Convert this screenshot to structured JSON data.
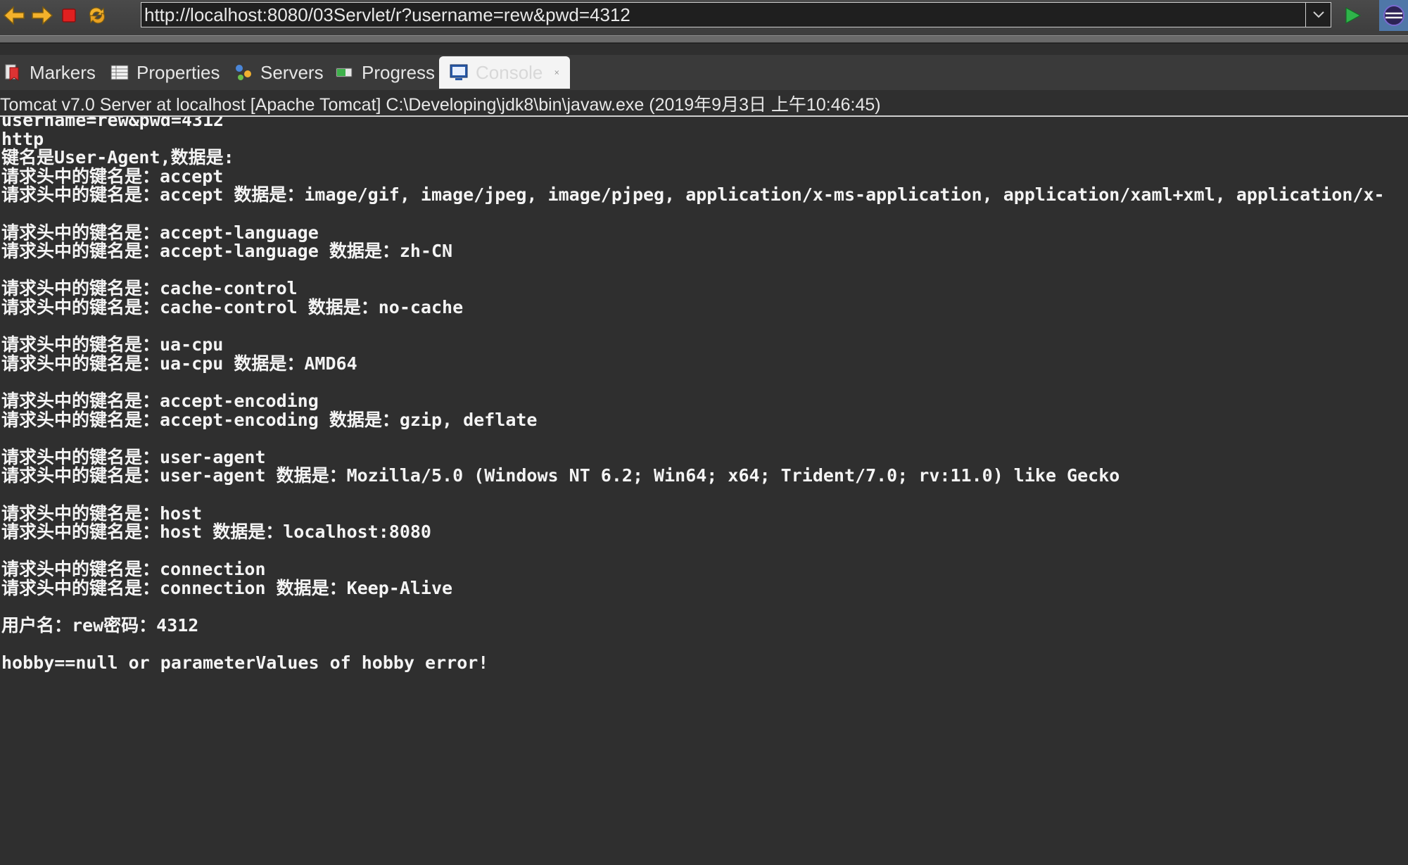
{
  "browser": {
    "url": "http://localhost:8080/03Servlet/r?username=rew&pwd=4312"
  },
  "tabs": [
    {
      "label": "Markers",
      "icon": "markers-icon"
    },
    {
      "label": "Properties",
      "icon": "properties-icon"
    },
    {
      "label": "Servers",
      "icon": "servers-icon"
    },
    {
      "label": "Progress",
      "icon": "progress-icon"
    },
    {
      "label": "Console",
      "icon": "console-icon",
      "active": true
    }
  ],
  "console": {
    "header": "Tomcat v7.0 Server at localhost [Apache Tomcat] C:\\Developing\\jdk8\\bin\\javaw.exe (2019年9月3日 上午10:46:45)",
    "cut_line": "/03Servlet/r",
    "lines": [
      "username=rew&pwd=4312",
      "http",
      "键名是User-Agent,数据是:",
      "请求头中的键名是：accept",
      "请求头中的键名是：accept 数据是：image/gif, image/jpeg, image/pjpeg, application/x-ms-application, application/xaml+xml, application/x-",
      "",
      "请求头中的键名是：accept-language",
      "请求头中的键名是：accept-language 数据是：zh-CN",
      "",
      "请求头中的键名是：cache-control",
      "请求头中的键名是：cache-control 数据是：no-cache",
      "",
      "请求头中的键名是：ua-cpu",
      "请求头中的键名是：ua-cpu 数据是：AMD64",
      "",
      "请求头中的键名是：accept-encoding",
      "请求头中的键名是：accept-encoding 数据是：gzip, deflate",
      "",
      "请求头中的键名是：user-agent",
      "请求头中的键名是：user-agent 数据是：Mozilla/5.0 (Windows NT 6.2; Win64; x64; Trident/7.0; rv:11.0) like Gecko",
      "",
      "请求头中的键名是：host",
      "请求头中的键名是：host 数据是：localhost:8080",
      "",
      "请求头中的键名是：connection",
      "请求头中的键名是：connection 数据是：Keep-Alive",
      "",
      "用户名：rew密码：4312",
      "",
      "hobby==null or parameterValues of hobby error!"
    ]
  },
  "colors": {
    "background": "#2f2f2f",
    "text": "#f4f4f4",
    "terminate_red": "#e02020",
    "go_green": "#2fb34a"
  }
}
